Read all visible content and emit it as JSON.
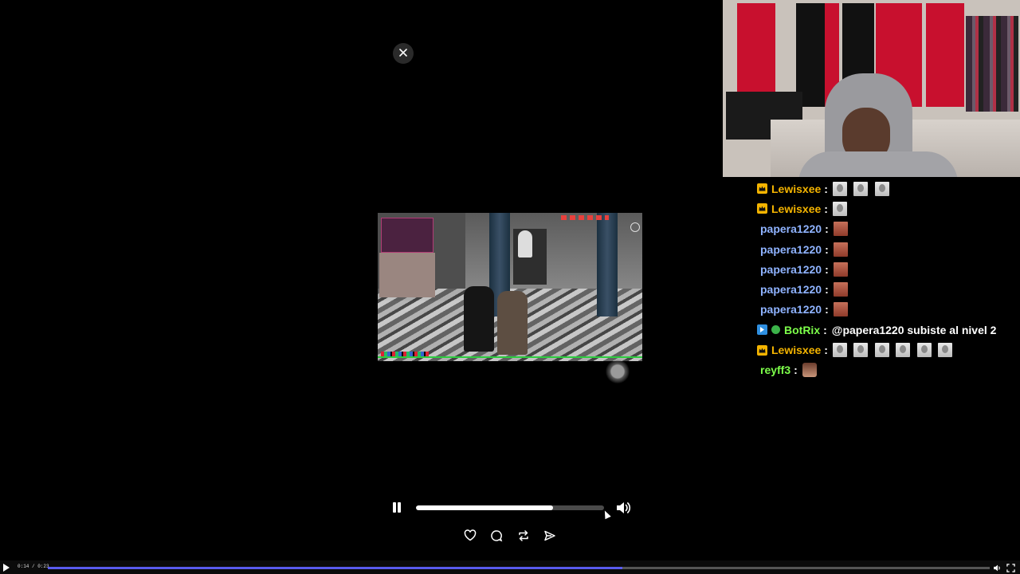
{
  "player": {
    "progress_fraction": 0.73,
    "icons": {
      "close": "close-icon",
      "pause": "pause-icon",
      "volume": "volume-icon"
    }
  },
  "actions": [
    {
      "name": "like",
      "icon": "heart-icon"
    },
    {
      "name": "comment",
      "icon": "comment-icon"
    },
    {
      "name": "repost",
      "icon": "repost-icon"
    },
    {
      "name": "share",
      "icon": "share-icon"
    }
  ],
  "chat": {
    "messages": [
      {
        "user": "Lewisxee",
        "badge": "crown",
        "color": "#f4b400",
        "emotes": [
          "pale",
          "pale",
          "pale"
        ]
      },
      {
        "user": "Lewisxee",
        "badge": "crown",
        "color": "#f4b400",
        "emotes": [
          "pale"
        ]
      },
      {
        "user": "papera1220",
        "badge": "",
        "color": "#8fb3ff",
        "emotes": [
          "red"
        ]
      },
      {
        "user": "papera1220",
        "badge": "",
        "color": "#8fb3ff",
        "emotes": [
          "red"
        ]
      },
      {
        "user": "papera1220",
        "badge": "",
        "color": "#8fb3ff",
        "emotes": [
          "red"
        ]
      },
      {
        "user": "papera1220",
        "badge": "",
        "color": "#8fb3ff",
        "emotes": [
          "red"
        ]
      },
      {
        "user": "papera1220",
        "badge": "",
        "color": "#8fb3ff",
        "emotes": [
          "red"
        ]
      },
      {
        "user": "BotRix",
        "badge": "bot",
        "verified": true,
        "color": "#7dff4a",
        "text": "@papera1220 subiste al nivel 2"
      },
      {
        "user": "Lewisxee",
        "badge": "crown",
        "color": "#f4b400",
        "emotes": [
          "pale",
          "pale",
          "pale",
          "pale",
          "pale",
          "pale"
        ]
      },
      {
        "user": "reyff3",
        "badge": "",
        "color": "#7dff4a",
        "emotes": [
          "face"
        ]
      }
    ]
  },
  "bottom_bar": {
    "time": "0:14 / 0:23",
    "progress_fraction": 0.61,
    "icons": [
      "volume-icon",
      "fullscreen-icon"
    ]
  },
  "colors": {
    "accent": "#5a5cf0",
    "background": "#000000"
  }
}
